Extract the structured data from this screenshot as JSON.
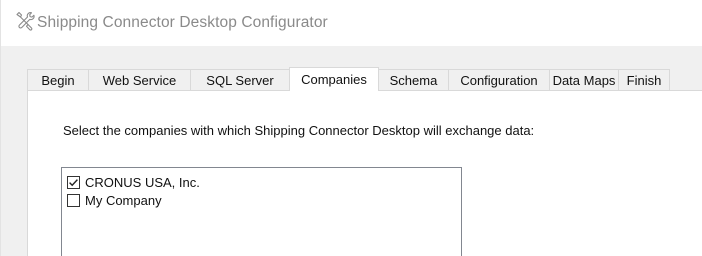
{
  "window": {
    "title": "Shipping Connector Desktop Configurator",
    "icon": "wrench-screwdriver-icon"
  },
  "tabs": [
    {
      "label": "Begin",
      "active": false
    },
    {
      "label": "Web Service",
      "active": false
    },
    {
      "label": "SQL Server",
      "active": false
    },
    {
      "label": "Companies",
      "active": true
    },
    {
      "label": "Schema",
      "active": false
    },
    {
      "label": "Configuration",
      "active": false
    },
    {
      "label": "Data Maps",
      "active": false
    },
    {
      "label": "Finish",
      "active": false
    }
  ],
  "companies_page": {
    "instruction": "Select the companies with which Shipping Connector Desktop will exchange data:",
    "companies": [
      {
        "label": "CRONUS USA, Inc.",
        "checked": true
      },
      {
        "label": "My Company",
        "checked": false
      }
    ]
  },
  "colors": {
    "title_text": "#8a8a8a",
    "dialog_background": "#f0f0f0",
    "panel_background": "#ffffff",
    "tab_border": "#d9d9d9",
    "list_border": "#828790"
  }
}
